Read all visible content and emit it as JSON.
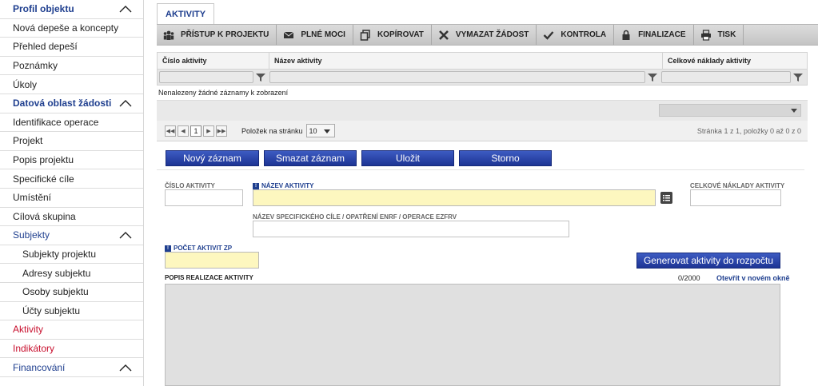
{
  "sidebar": {
    "items": [
      {
        "label": "Profil objektu",
        "kind": "section",
        "chevron": true
      },
      {
        "label": "Nová depeše a koncepty",
        "kind": "item"
      },
      {
        "label": "Přehled depeší",
        "kind": "item"
      },
      {
        "label": "Poznámky",
        "kind": "item"
      },
      {
        "label": "Úkoly",
        "kind": "item"
      },
      {
        "label": "Datová oblast žádosti",
        "kind": "section",
        "chevron": true
      },
      {
        "label": "Identifikace operace",
        "kind": "item"
      },
      {
        "label": "Projekt",
        "kind": "item"
      },
      {
        "label": "Popis projektu",
        "kind": "item"
      },
      {
        "label": "Specifické cíle",
        "kind": "item"
      },
      {
        "label": "Umístění",
        "kind": "item"
      },
      {
        "label": "Cílová skupina",
        "kind": "item"
      },
      {
        "label": "Subjekty",
        "kind": "section-light",
        "chevron": true
      },
      {
        "label": "Subjekty projektu",
        "kind": "sub"
      },
      {
        "label": "Adresy subjektu",
        "kind": "sub"
      },
      {
        "label": "Osoby subjektu",
        "kind": "sub"
      },
      {
        "label": "Účty subjektu",
        "kind": "sub"
      },
      {
        "label": "Aktivity",
        "kind": "red"
      },
      {
        "label": "Indikátory",
        "kind": "red"
      },
      {
        "label": "Financování",
        "kind": "section-light",
        "chevron": true
      }
    ]
  },
  "tab": {
    "label": "AKTIVITY"
  },
  "toolbar": {
    "buttons": [
      {
        "label": "PŘÍSTUP K PROJEKTU",
        "icon": "users-icon"
      },
      {
        "label": "PLNÉ MOCI",
        "icon": "envelope-icon"
      },
      {
        "label": "KOPÍROVAT",
        "icon": "copy-icon"
      },
      {
        "label": "VYMAZAT ŽÁDOST",
        "icon": "x-icon"
      },
      {
        "label": "KONTROLA",
        "icon": "check-icon"
      },
      {
        "label": "FINALIZACE",
        "icon": "lock-icon"
      },
      {
        "label": "TISK",
        "icon": "printer-icon"
      }
    ]
  },
  "grid": {
    "columns": [
      "Číslo aktivity",
      "Název aktivity",
      "Celkové náklady aktivity"
    ],
    "empty_message": "Nenalezeny žádné záznamy k zobrazení",
    "pager": {
      "page": "1",
      "per_page_label": "Položek na stránku",
      "per_page": "10",
      "info": "Stránka 1 z 1, položky 0 až 0 z 0"
    }
  },
  "actions": {
    "new": "Nový záznam",
    "delete": "Smazat záznam",
    "save": "Uložit",
    "cancel": "Storno"
  },
  "form": {
    "cislo_label": "ČÍSLO AKTIVITY",
    "nazev_label": "NÁZEV AKTIVITY",
    "naklady_label": "CELKOVÉ NÁKLADY AKTIVITY",
    "spec_cil_label": "NÁZEV SPECIFICKÉHO CÍLE / OPATŘENÍ ENRF / OPERACE EZFRV",
    "pocet_label": "POČET AKTIVIT ZP",
    "generate_button": "Generovat aktivity do rozpočtu",
    "popis_label": "POPIS REALIZACE AKTIVITY",
    "char_count": "0/2000",
    "open_new_window": "Otevřít v novém okně",
    "required_badge": "!"
  },
  "colors": {
    "accent": "#1f3f8f",
    "required_fill": "#fdf7bf",
    "nav_red": "#c8102e"
  }
}
